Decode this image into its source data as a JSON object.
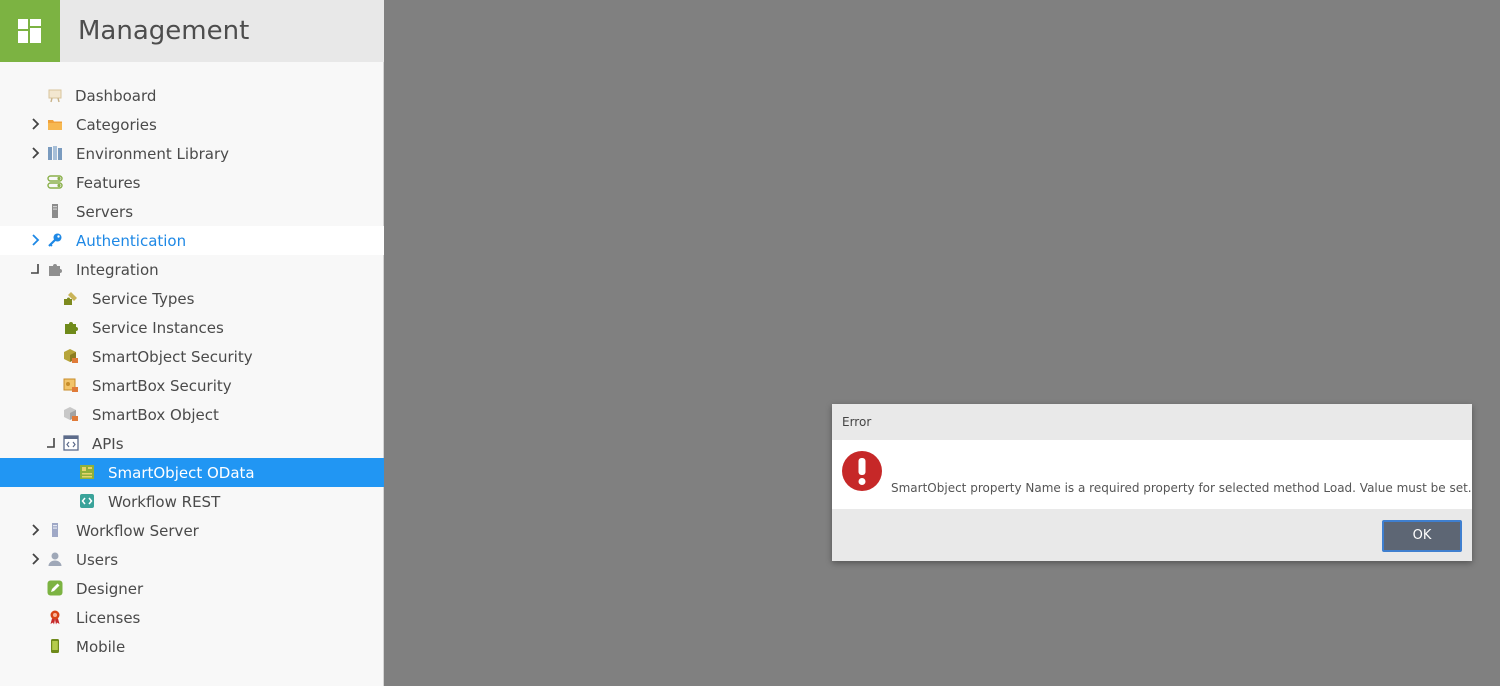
{
  "header": {
    "title": "Management"
  },
  "tree": [
    {
      "label": "Dashboard",
      "icon": "dashboard-icon",
      "expander": "none"
    },
    {
      "label": "Categories",
      "icon": "folder-icon",
      "expander": "collapsed"
    },
    {
      "label": "Environment Library",
      "icon": "library-icon",
      "expander": "collapsed"
    },
    {
      "label": "Features",
      "icon": "features-icon",
      "expander": "none"
    },
    {
      "label": "Servers",
      "icon": "server-icon",
      "expander": "none"
    },
    {
      "label": "Authentication",
      "icon": "key-icon",
      "expander": "collapsed",
      "state": "hover"
    },
    {
      "label": "Integration",
      "icon": "puzzle-icon",
      "expander": "expanded"
    },
    {
      "label": "Service Types",
      "icon": "service-types-icon",
      "expander": "none"
    },
    {
      "label": "Service Instances",
      "icon": "puzzle-green-icon",
      "expander": "none"
    },
    {
      "label": "SmartObject Security",
      "icon": "smartobject-lock-icon",
      "expander": "none"
    },
    {
      "label": "SmartBox Security",
      "icon": "smartbox-lock-icon",
      "expander": "none"
    },
    {
      "label": "SmartBox Object",
      "icon": "smartbox-object-icon",
      "expander": "none"
    },
    {
      "label": "APIs",
      "icon": "api-icon",
      "expander": "expanded"
    },
    {
      "label": "SmartObject OData",
      "icon": "odata-icon",
      "expander": "none",
      "state": "selected"
    },
    {
      "label": "Workflow REST",
      "icon": "rest-icon",
      "expander": "none"
    },
    {
      "label": "Workflow Server",
      "icon": "workflow-server-icon",
      "expander": "collapsed"
    },
    {
      "label": "Users",
      "icon": "user-icon",
      "expander": "collapsed"
    },
    {
      "label": "Designer",
      "icon": "pencil-icon",
      "expander": "none"
    },
    {
      "label": "Licenses",
      "icon": "ribbon-icon",
      "expander": "none"
    },
    {
      "label": "Mobile",
      "icon": "mobile-icon",
      "expander": "none"
    }
  ],
  "dialog": {
    "title": "Error",
    "message": "SmartObject property Name is a required property for selected method Load. Value must be set.",
    "ok_label": "OK"
  },
  "colors": {
    "brand_green": "#7cb342",
    "selected_blue": "#2196f3",
    "hover_text_blue": "#1e88e5",
    "overlay_gray": "#808080",
    "error_red": "#c62828",
    "ok_button": "#5d6674"
  }
}
